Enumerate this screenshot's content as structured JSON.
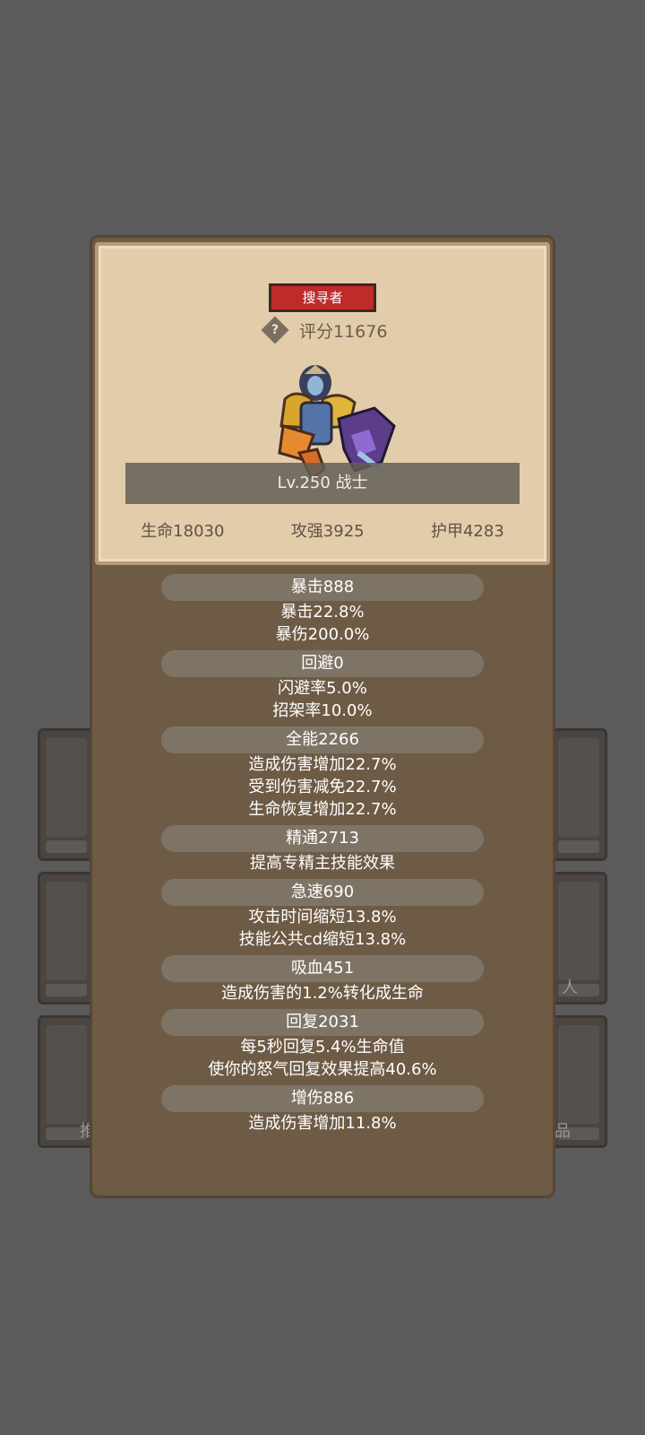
{
  "background_slots": {
    "left": [
      "",
      "",
      "推"
    ],
    "right": [
      "",
      "人",
      "品"
    ]
  },
  "card": {
    "class_badge": "搜寻者",
    "score": "评分11676",
    "level_class": "Lv.250 战士",
    "hp": "生命18030",
    "atk": "攻强3925",
    "armor": "护甲4283"
  },
  "stats": {
    "crit": {
      "title": "暴击888",
      "lines": [
        "暴击22.8%",
        "暴伤200.0%"
      ]
    },
    "dodge": {
      "title": "回避0",
      "lines": [
        "闪避率5.0%",
        "招架率10.0%"
      ]
    },
    "versatility": {
      "title": "全能2266",
      "lines": [
        "造成伤害增加22.7%",
        "受到伤害减免22.7%",
        "生命恢复增加22.7%"
      ]
    },
    "mastery": {
      "title": "精通2713",
      "lines": [
        "提高专精主技能效果"
      ]
    },
    "haste": {
      "title": "急速690",
      "lines": [
        "攻击时间缩短13.8%",
        "技能公共cd缩短13.8%"
      ]
    },
    "leech": {
      "title": "吸血451",
      "lines": [
        "造成伤害的1.2%转化成生命"
      ]
    },
    "regen": {
      "title": "回复2031",
      "lines": [
        "每5秒回复5.4%生命值",
        "使你的怒气回复效果提高40.6%"
      ]
    },
    "damage": {
      "title": "增伤886",
      "lines": [
        "造成伤害增加11.8%"
      ]
    }
  },
  "colors": {
    "page_bg": "#5b5b5b",
    "panel_bg": "#6e5b45",
    "card_bg": "#e3ccaa",
    "badge_red": "#bf2b2b",
    "section_pill": "#7e7466"
  }
}
